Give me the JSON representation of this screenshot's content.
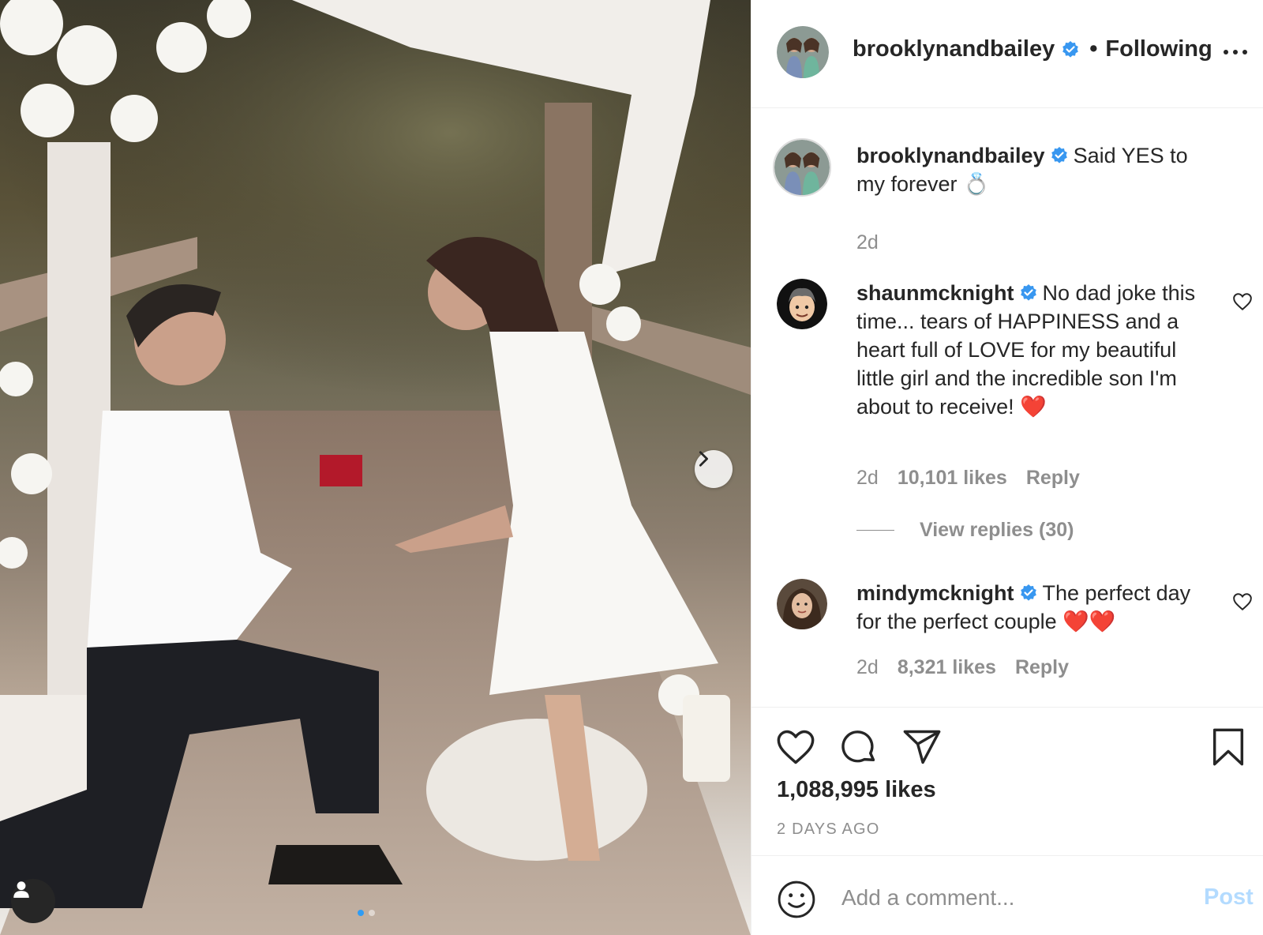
{
  "post": {
    "username": "brooklynandbailey",
    "follow_status": "Following",
    "separator": "•"
  },
  "caption": {
    "username": "brooklynandbailey",
    "text": "Said YES to my forever 💍",
    "time": "2d"
  },
  "comments": [
    {
      "username": "shaunmcknight",
      "text": "No dad joke this time... tears of HAPPINESS and a heart full of LOVE for my beautiful little girl and the incredible son I'm about to receive! ❤️",
      "time": "2d",
      "likes": "10,101 likes",
      "reply": "Reply",
      "view_replies": "View replies (30)"
    },
    {
      "username": "mindymcknight",
      "text": "The perfect day for the perfect couple ❤️❤️",
      "time": "2d",
      "likes": "8,321 likes",
      "reply": "Reply"
    }
  ],
  "stats": {
    "likes": "1,088,995 likes",
    "time_ago": "2 DAYS AGO"
  },
  "add_comment": {
    "placeholder": "Add a comment...",
    "post_label": "Post"
  },
  "icons": {
    "verified": "verified-badge-icon",
    "more": "more-options-icon",
    "like": "heart-icon",
    "comment": "comment-bubble-icon",
    "share": "paper-plane-icon",
    "save": "bookmark-icon",
    "emoji": "smiley-icon",
    "next": "chevron-right-icon",
    "tag": "user-tag-icon"
  },
  "colors": {
    "verified_blue": "#3897f0",
    "post_disabled": "#b3dbff",
    "muted_text": "#8e8e8e"
  },
  "carousel": {
    "total": 2,
    "active": 1
  }
}
